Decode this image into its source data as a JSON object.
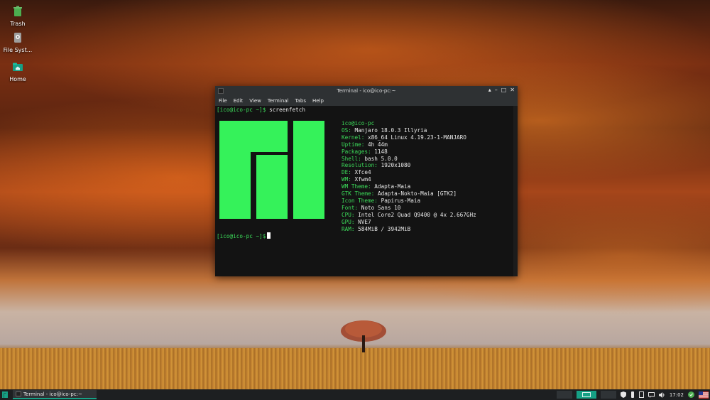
{
  "desktop": {
    "icons": [
      {
        "label": "Trash",
        "icon": "trash-icon"
      },
      {
        "label": "File Syst...",
        "icon": "drive-icon"
      },
      {
        "label": "Home",
        "icon": "home-folder-icon"
      }
    ]
  },
  "terminal": {
    "title": "Terminal - ico@ico-pc:~",
    "menu": [
      "File",
      "Edit",
      "View",
      "Terminal",
      "Tabs",
      "Help"
    ],
    "prompt": "[ico@ico-pc ~]$",
    "command": "screenfetch",
    "user_host": "ico@ico-pc",
    "info": [
      {
        "key": "OS:",
        "value": "Manjaro 18.0.3 Illyria"
      },
      {
        "key": "Kernel:",
        "value": "x86_64 Linux 4.19.23-1-MANJARO"
      },
      {
        "key": "Uptime:",
        "value": "4h 44m"
      },
      {
        "key": "Packages:",
        "value": "1148"
      },
      {
        "key": "Shell:",
        "value": "bash 5.0.0"
      },
      {
        "key": "Resolution:",
        "value": "1920x1080"
      },
      {
        "key": "DE:",
        "value": "Xfce4"
      },
      {
        "key": "WM:",
        "value": "Xfwm4"
      },
      {
        "key": "WM Theme:",
        "value": "Adapta-Maia"
      },
      {
        "key": "GTK Theme:",
        "value": "Adapta-Nokto-Maia [GTK2]"
      },
      {
        "key": "Icon Theme:",
        "value": "Papirus-Maia"
      },
      {
        "key": "Font:",
        "value": "Noto Sans 10"
      },
      {
        "key": "CPU:",
        "value": "Intel Core2 Quad Q9400 @ 4x 2.667GHz"
      },
      {
        "key": "GPU:",
        "value": "NVE7"
      },
      {
        "key": "RAM:",
        "value": "584MiB / 3942MiB"
      }
    ],
    "colors": {
      "logo": "#35f25a",
      "key": "#3cdc5a"
    }
  },
  "taskbar": {
    "task_label": "Terminal - ico@ico-pc:~",
    "clock": "17:02",
    "accent": "#16a085"
  }
}
